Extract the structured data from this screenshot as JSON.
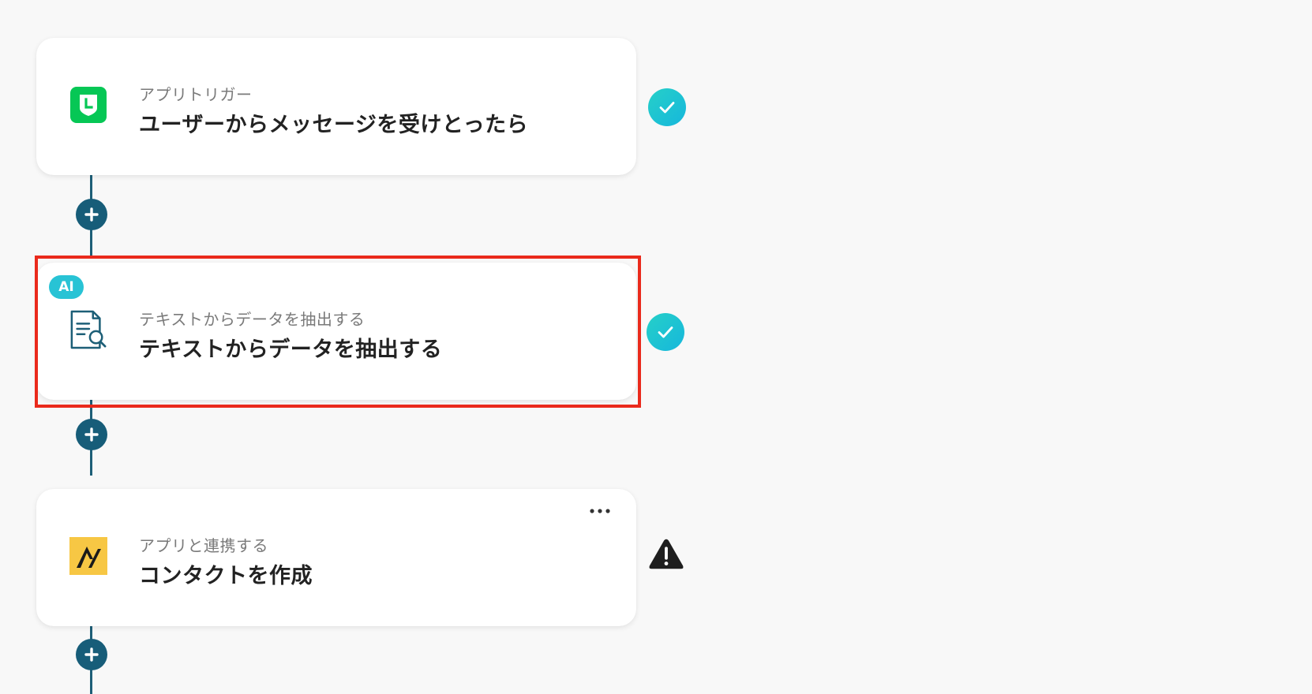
{
  "flow": {
    "steps": [
      {
        "id": "trigger",
        "subtitle": "アプリトリガー",
        "title": "ユーザーからメッセージを受けとったら",
        "icon": "line-app-icon",
        "status": "completed"
      },
      {
        "id": "ai-extract",
        "badge": "AI",
        "subtitle": "テキストからデータを抽出する",
        "title": "テキストからデータを抽出する",
        "icon": "document-search-icon",
        "status": "completed",
        "highlighted": true
      },
      {
        "id": "create-contact",
        "subtitle": "アプリと連携する",
        "title": "コンタクトを作成",
        "icon": "app-logo-icon",
        "status": "warning"
      }
    ]
  },
  "colors": {
    "accent": "#175d79",
    "check": "#1fc4d5",
    "highlight": "#ea2a1c",
    "line_green": "#06c755",
    "app_yellow": "#f7c744"
  }
}
